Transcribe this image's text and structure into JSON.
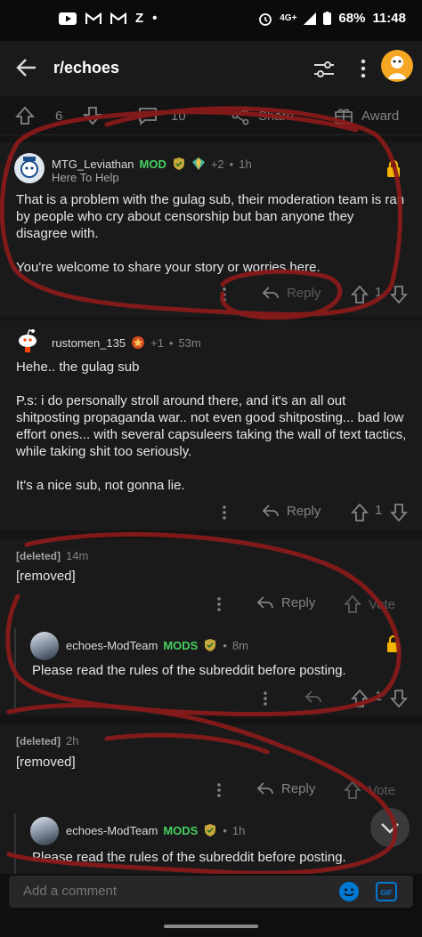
{
  "status_bar": {
    "icons": [
      "youtube-icon",
      "gmail-icon",
      "gmail-icon",
      "z-app-icon",
      "dot-icon"
    ],
    "network": "4G+",
    "battery": "68%",
    "time": "11:48"
  },
  "app_bar": {
    "title": "r/echoes"
  },
  "post_actions": {
    "votes": "6",
    "comments": "10",
    "share_label": "Share",
    "award_label": "Award"
  },
  "comments": [
    {
      "author": "MTG_Leviathan",
      "badge": "MOD",
      "extra": "+2",
      "time": "1h",
      "flair": "Here To Help",
      "body1": "That is a problem with the gulag sub, their moderation team is ran by people who cry about censorship but ban anyone they disagree with.",
      "body2": "You're welcome to share your story or worries here.",
      "reply_label": "Reply",
      "score": "1",
      "locked": true
    },
    {
      "author": "rustomen_135",
      "extra": "+1",
      "time": "53m",
      "body1": "Hehe.. the gulag sub",
      "body2": "P.s: i do personally stroll around there, and it's an all out shitposting propaganda war.. not even good shitposting... bad low effort ones... with several capsuleers taking the wall of text tactics, while taking shit too seriously.",
      "body3": "It's a nice sub, not gonna lie.",
      "reply_label": "Reply",
      "score": "1"
    },
    {
      "author": "[deleted]",
      "time": "14m",
      "body1": "[removed]",
      "reply_label": "Reply",
      "vote_label": "Vote"
    },
    {
      "author": "echoes-ModTeam",
      "badge": "MODS",
      "time": "8m",
      "body1": "Please read the rules of the subreddit before posting.",
      "score": "1",
      "locked": true
    },
    {
      "author": "[deleted]",
      "time": "2h",
      "body1": "[removed]",
      "reply_label": "Reply",
      "vote_label": "Vote"
    },
    {
      "author": "echoes-ModTeam",
      "badge": "MODS",
      "time": "1h",
      "body1": "Please read the rules of the subreddit before posting."
    }
  ],
  "composer": {
    "placeholder": "Add a comment",
    "gif_label": "GIF"
  },
  "colors": {
    "mod_green": "#46d160",
    "scribble_red": "#8b1a1a",
    "accent_blue": "#0079d3"
  }
}
